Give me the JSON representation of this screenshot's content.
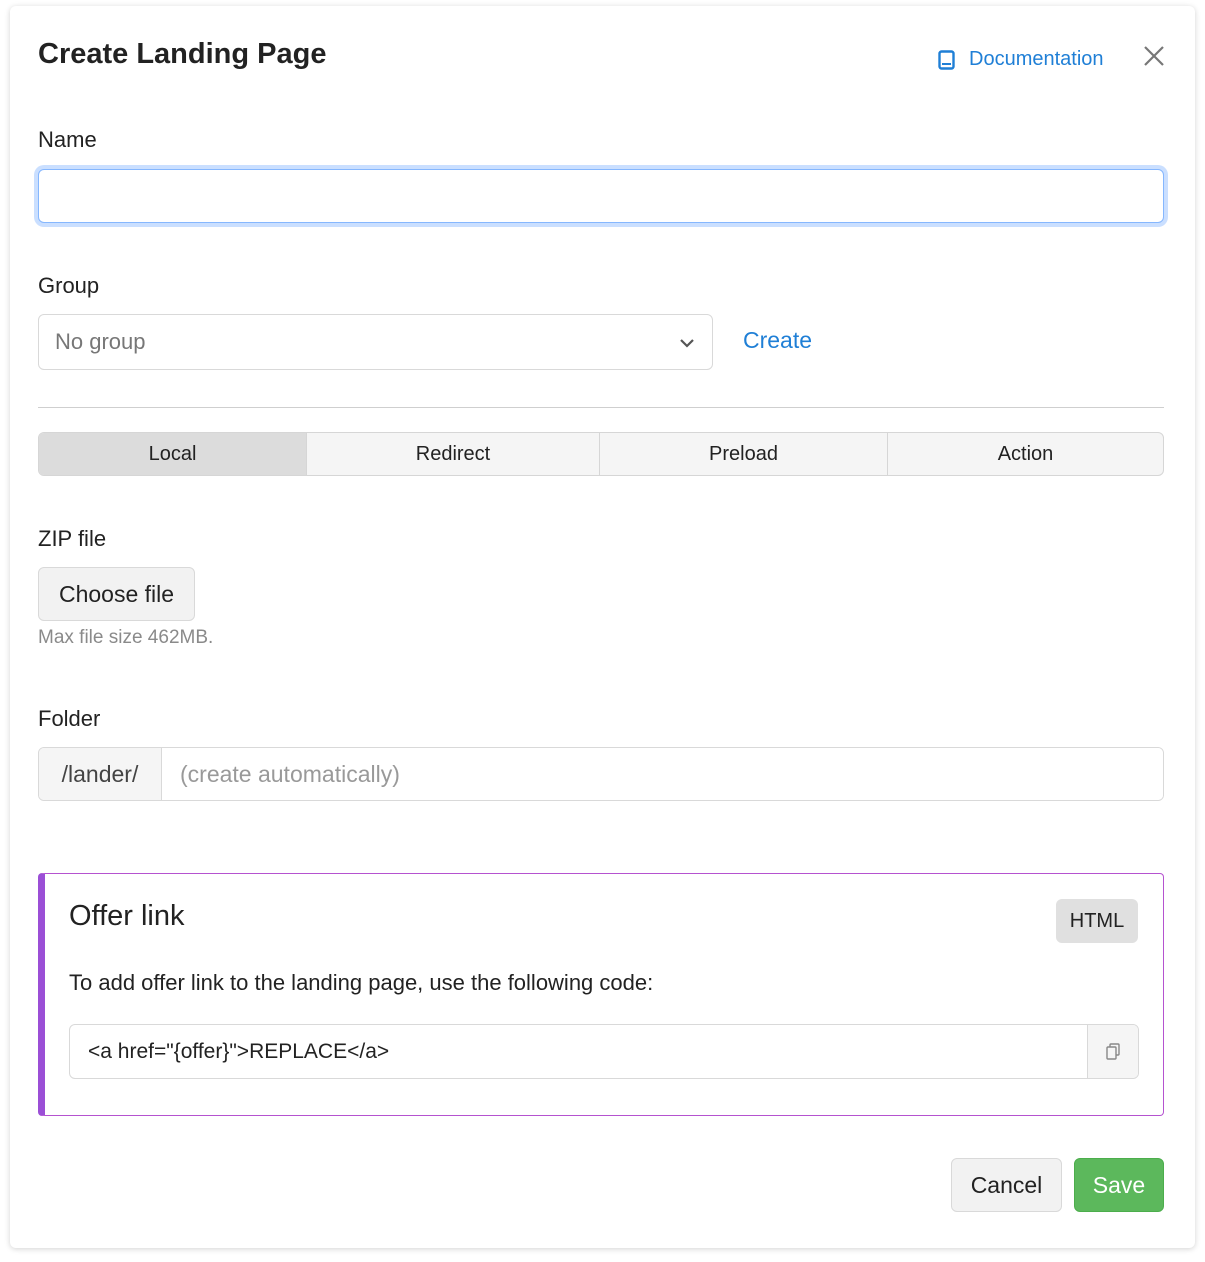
{
  "modal": {
    "title": "Create Landing Page",
    "documentation_label": "Documentation",
    "accent_color": "#1f7fd6"
  },
  "name_field": {
    "label": "Name",
    "value": ""
  },
  "group_field": {
    "label": "Group",
    "selected": "No group",
    "create_label": "Create"
  },
  "tabs": [
    {
      "label": "Local",
      "active": true
    },
    {
      "label": "Redirect",
      "active": false
    },
    {
      "label": "Preload",
      "active": false
    },
    {
      "label": "Action",
      "active": false
    }
  ],
  "zip_field": {
    "label": "ZIP file",
    "button_label": "Choose file",
    "hint": "Max file size 462MB."
  },
  "folder_field": {
    "label": "Folder",
    "prefix": "/lander/",
    "placeholder": "(create automatically)"
  },
  "offer_link": {
    "title": "Offer link",
    "badge": "HTML",
    "description": "To add offer link to the landing page, use the following code:",
    "code": "<a href=\"{offer}\">REPLACE</a>",
    "border_color": "#9b4fd6"
  },
  "footer": {
    "cancel_label": "Cancel",
    "save_label": "Save",
    "save_color": "#5cb85c"
  },
  "icons": [
    "book-icon",
    "close-icon",
    "chevron-down-icon",
    "copy-icon"
  ]
}
